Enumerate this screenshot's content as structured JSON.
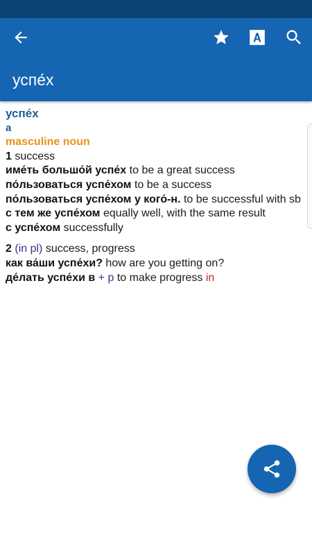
{
  "app_bar": {
    "title": "успе́х",
    "icons": [
      "arrow-back-icon",
      "star-icon",
      "font-a-icon",
      "search-icon"
    ]
  },
  "entry": {
    "headword": "успе́х",
    "stress_class": "a",
    "pos": "masculine noun",
    "senses": [
      {
        "number": "1",
        "gloss": "success",
        "phrases": [
          {
            "ru": "име́ть большо́й успе́х",
            "en": "to be a great success"
          },
          {
            "ru": "по́льзоваться успе́хом",
            "en": "to be a success"
          },
          {
            "ru": "по́льзоваться успе́хом у кого́-н.",
            "en": "to be successful with sb"
          },
          {
            "ru": "с тем же успе́хом",
            "en": "equally well, with the same result"
          },
          {
            "ru": "с успе́хом",
            "en": "successfully"
          }
        ]
      },
      {
        "number": "2",
        "label": "(in pl)",
        "gloss": "success, progress",
        "phrases": [
          {
            "ru": "как ва́ши успе́хи?",
            "en": "how are you getting on?"
          },
          {
            "ru": "де́лать успе́хи в",
            "marker": "+ p",
            "en": "to make progress",
            "en_extra": "in"
          }
        ]
      }
    ]
  },
  "fab": {
    "icon": "share-icon"
  },
  "colors": {
    "status_bar": "#0c4372",
    "app_bar": "#1565b2",
    "headword": "#1b5e95",
    "pos": "#e8921a",
    "label": "#3a2f8f",
    "highlight_red": "#c62828"
  }
}
